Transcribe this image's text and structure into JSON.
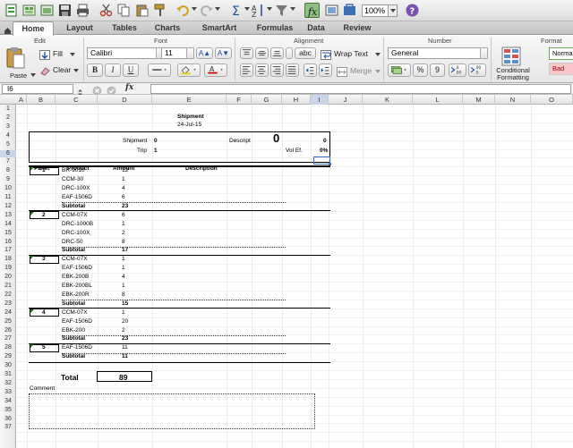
{
  "toolbar": {
    "icons": [
      "new-icon",
      "templates-icon",
      "open-icon",
      "save-icon",
      "print-icon",
      "cut-icon",
      "copy-icon",
      "paste-icon",
      "format-painter-icon",
      "undo-icon",
      "redo-icon",
      "autosum-icon",
      "sort-icon",
      "filter-icon",
      "formula-builder-icon",
      "media-browser-icon",
      "gallery-icon",
      "toolbox-icon",
      "help-icon"
    ],
    "zoom": "100%"
  },
  "ribbon_tabs": [
    "Home",
    "Layout",
    "Tables",
    "Charts",
    "SmartArt",
    "Formulas",
    "Data",
    "Review"
  ],
  "ribbon": {
    "groups": [
      "Edit",
      "Font",
      "Alignment",
      "Number",
      "Format"
    ],
    "paste_label": "Paste",
    "fill_label": "Fill",
    "clear_label": "Clear",
    "font_name": "Calibri",
    "font_size": "11",
    "bold": "B",
    "italic": "I",
    "underline": "U",
    "abc": "abc",
    "wrap_text": "Wrap Text",
    "merge": "Merge",
    "number_format": "General",
    "percent": "%",
    "comma": "9",
    "inc_decimal": ".00\n.0",
    "dec_decimal": ".0\n.00",
    "conditional_formatting": "Conditional Formatting",
    "style_normal": "Normal",
    "style_bad": "Bad"
  },
  "formula_bar": {
    "cell_ref": "I6",
    "fx": "fx",
    "value": ""
  },
  "columns": [
    "A",
    "B",
    "C",
    "D",
    "E",
    "F",
    "G",
    "H",
    "I",
    "J",
    "K",
    "L",
    "M",
    "N",
    "O"
  ],
  "rows": [
    "1",
    "2",
    "3",
    "4",
    "5",
    "6",
    "7",
    "8",
    "9",
    "10",
    "11",
    "12",
    "13",
    "14",
    "15",
    "16",
    "17",
    "18",
    "19",
    "20",
    "21",
    "22",
    "23",
    "24",
    "25",
    "26",
    "27",
    "28",
    "29",
    "30",
    "31",
    "32",
    "33",
    "34",
    "35",
    "36",
    "37"
  ],
  "sheet": {
    "title": "Shipment",
    "date": "24-Jul-15",
    "shipment_label": "Shipment",
    "shipment_value": "0",
    "trip_label": "Trip",
    "trip_value": "1",
    "descript_label": "Descript",
    "descript_big": "0",
    "descript_value": "0",
    "vol_label": "Vol Ef.",
    "vol_value": "0%",
    "headers": {
      "pallet": "Pallet",
      "product": "Product",
      "amount": "Amount",
      "description": "Description"
    },
    "lines": [
      {
        "pallet": "1",
        "product": "BR-9010",
        "amount": "12"
      },
      {
        "pallet": "",
        "product": "CCM-30",
        "amount": "1"
      },
      {
        "pallet": "",
        "product": "DRC-100X",
        "amount": "4"
      },
      {
        "pallet": "",
        "product": "EAF-1506D",
        "amount": "6"
      },
      {
        "pallet": "",
        "product": "Subtotal",
        "amount": "23"
      },
      {
        "pallet": "2",
        "product": "CCM-07X",
        "amount": "6"
      },
      {
        "pallet": "",
        "product": "DRC-1000B",
        "amount": "1"
      },
      {
        "pallet": "",
        "product": "DRC-100X",
        "amount": "2"
      },
      {
        "pallet": "",
        "product": "DRC-50",
        "amount": "8"
      },
      {
        "pallet": "",
        "product": "Subtotal",
        "amount": "17"
      },
      {
        "pallet": "3",
        "product": "CCM-07X",
        "amount": "1"
      },
      {
        "pallet": "",
        "product": "EAF-1506D",
        "amount": "1"
      },
      {
        "pallet": "",
        "product": "EBK-200B",
        "amount": "4"
      },
      {
        "pallet": "",
        "product": "EBK-200BL",
        "amount": "1"
      },
      {
        "pallet": "",
        "product": "EBK-200R",
        "amount": "8"
      },
      {
        "pallet": "",
        "product": "Subtotal",
        "amount": "15"
      },
      {
        "pallet": "4",
        "product": "CCM-07X",
        "amount": "1"
      },
      {
        "pallet": "",
        "product": "EAF-1506D",
        "amount": "20"
      },
      {
        "pallet": "",
        "product": "EBK-200",
        "amount": "2"
      },
      {
        "pallet": "",
        "product": "Subtotal",
        "amount": "23"
      },
      {
        "pallet": "5",
        "product": "EAF-1506D",
        "amount": "11"
      },
      {
        "pallet": "",
        "product": "Subtotal",
        "amount": "11"
      }
    ],
    "total_label": "Total",
    "total_value": "89",
    "comment_label": "Comment"
  }
}
